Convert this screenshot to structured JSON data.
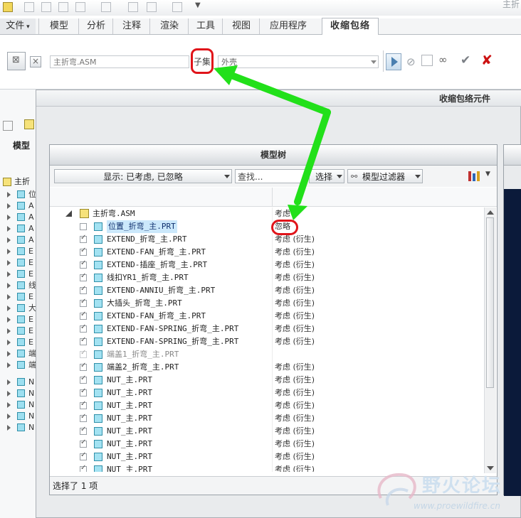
{
  "app": {
    "window_title_fragment": "主折",
    "accent": "#2f8fa8"
  },
  "ribbon": {
    "tabs": [
      {
        "label": "文件",
        "dropdown": true
      },
      {
        "label": "模型"
      },
      {
        "label": "分析"
      },
      {
        "label": "注释"
      },
      {
        "label": "渲染"
      },
      {
        "label": "工具"
      },
      {
        "label": "视图"
      },
      {
        "label": "应用程序"
      },
      {
        "label": "收缩包络",
        "active": true
      }
    ],
    "model_field": "主折弯.ASM",
    "subset_label": "子集",
    "type_combo": "外壳"
  },
  "left_panel": {
    "tab_label": "模型",
    "root_label": "主折",
    "rows": [
      "位",
      "A",
      "A",
      "A",
      "A",
      "E",
      "E",
      "E",
      "线",
      "E",
      "大",
      "E",
      "E",
      "E",
      "端",
      "端",
      "N",
      "N",
      "N",
      "N",
      "N"
    ]
  },
  "dialog": {
    "title": "收缩包络元件",
    "tree": {
      "header": "模型树",
      "show_filter": "显示: 已考虑, 已忽略",
      "find_placeholder": "查找...",
      "select_label": "选择",
      "filter_label": "模型过滤器",
      "rows": [
        {
          "name": "主折弯.ASM",
          "status": "考虑",
          "type": "asm",
          "checked": null
        },
        {
          "name": "位置_折弯_主.PRT",
          "status": "忽略",
          "type": "part",
          "checked": false,
          "selected": true
        },
        {
          "name": "EXTEND_折弯_主.PRT",
          "status": "考虑 (衍生)",
          "type": "part",
          "checked": true
        },
        {
          "name": "EXTEND-FAN_折弯_主.PRT",
          "status": "考虑 (衍生)",
          "type": "part",
          "checked": true
        },
        {
          "name": "EXTEND-插座_折弯_主.PRT",
          "status": "考虑 (衍生)",
          "type": "part",
          "checked": true
        },
        {
          "name": "线扣YR1_折弯_主.PRT",
          "status": "考虑 (衍生)",
          "type": "part",
          "checked": true
        },
        {
          "name": "EXTEND-ANNIU_折弯_主.PRT",
          "status": "考虑 (衍生)",
          "type": "part",
          "checked": true
        },
        {
          "name": "大插头_折弯_主.PRT",
          "status": "考虑 (衍生)",
          "type": "part",
          "checked": true
        },
        {
          "name": "EXTEND-FAN_折弯_主.PRT",
          "status": "考虑 (衍生)",
          "type": "part",
          "checked": true
        },
        {
          "name": "EXTEND-FAN-SPRING_折弯_主.PRT",
          "status": "考虑 (衍生)",
          "type": "part",
          "checked": true
        },
        {
          "name": "EXTEND-FAN-SPRING_折弯_主.PRT",
          "status": "考虑 (衍生)",
          "type": "part",
          "checked": true
        },
        {
          "name": "端盖1_折弯_主.PRT",
          "status": "",
          "type": "part",
          "checked": true,
          "dim": true
        },
        {
          "name": "端盖2_折弯_主.PRT",
          "status": "考虑 (衍生)",
          "type": "part",
          "checked": true
        },
        {
          "name": "NUT_主.PRT",
          "status": "考虑 (衍生)",
          "type": "part",
          "checked": true
        },
        {
          "name": "NUT_主.PRT",
          "status": "考虑 (衍生)",
          "type": "part",
          "checked": true
        },
        {
          "name": "NUT_主.PRT",
          "status": "考虑 (衍生)",
          "type": "part",
          "checked": true
        },
        {
          "name": "NUT_主.PRT",
          "status": "考虑 (衍生)",
          "type": "part",
          "checked": true
        },
        {
          "name": "NUT_主.PRT",
          "status": "考虑 (衍生)",
          "type": "part",
          "checked": true
        },
        {
          "name": "NUT_主.PRT",
          "status": "考虑 (衍生)",
          "type": "part",
          "checked": true
        },
        {
          "name": "NUT_主.PRT",
          "status": "考虑 (衍生)",
          "type": "part",
          "checked": true
        },
        {
          "name": "NUT_主.PRT",
          "status": "考虑 (衍生)",
          "type": "part",
          "checked": true
        }
      ],
      "status_bar": "选择了 1 项"
    }
  },
  "annotations": {
    "highlight_color": "#e0141a",
    "arrow_color": "#22e01a"
  },
  "watermark": {
    "title": "野火论坛",
    "url": "www.proewildfire.cn"
  }
}
